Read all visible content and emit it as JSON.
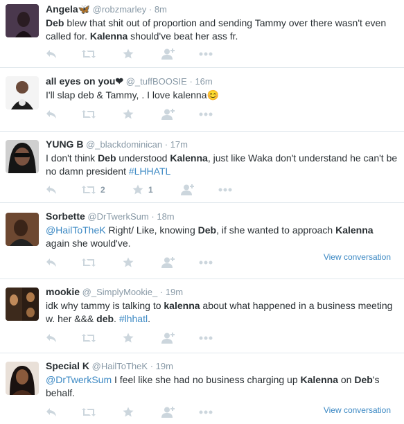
{
  "colors": {
    "link": "#3b88c3",
    "meta": "#8899a6",
    "action_icon": "#ccd6dd",
    "text": "#292f33",
    "divider": "#e1e8ed"
  },
  "tweets": [
    {
      "name": "Angela🦋",
      "handle": "@robzmarley",
      "time": "8m",
      "text": [
        {
          "b": "Deb"
        },
        {
          "t": " blew that shit out of proportion and sending Tammy over there wasn't even called for. "
        },
        {
          "b": "Kalenna"
        },
        {
          "t": " should've beat her ass fr."
        }
      ],
      "retweets": "",
      "favorites": "",
      "view_conversation": ""
    },
    {
      "name": "all eyes on you❤",
      "handle": "@_tuffBOOSIE",
      "time": "16m",
      "text": [
        {
          "t": "I'll slap deb & Tammy, . I love kalenna😊"
        }
      ],
      "retweets": "",
      "favorites": "",
      "view_conversation": ""
    },
    {
      "name": "YUNG B",
      "handle": "@_blackdominican",
      "time": "17m",
      "text": [
        {
          "t": "I don't think "
        },
        {
          "b": "Deb"
        },
        {
          "t": " understood "
        },
        {
          "b": "Kalenna"
        },
        {
          "t": ", just like Waka don't understand he can't be no damn president  "
        },
        {
          "l": "#LHHATL"
        }
      ],
      "retweets": "2",
      "favorites": "1",
      "view_conversation": ""
    },
    {
      "name": "Sorbette",
      "handle": "@DrTwerkSum",
      "time": "18m",
      "text": [
        {
          "l": "@HailToTheK"
        },
        {
          "t": " Right/ Like, knowing "
        },
        {
          "b": "Deb"
        },
        {
          "t": ", if she wanted to approach "
        },
        {
          "b": "Kalenna"
        },
        {
          "t": " again she would've."
        }
      ],
      "retweets": "",
      "favorites": "",
      "view_conversation": "View conversation"
    },
    {
      "name": "mookie",
      "handle": "@_SimplyMookie_",
      "time": "19m",
      "text": [
        {
          "t": "idk why tammy is talking to "
        },
        {
          "b": "kalenna"
        },
        {
          "t": " about what happened in a business meeting w. her &&& "
        },
        {
          "b": "deb"
        },
        {
          "t": ". "
        },
        {
          "l": "#lhhatl"
        },
        {
          "t": "."
        }
      ],
      "retweets": "",
      "favorites": "",
      "view_conversation": ""
    },
    {
      "name": "Special K",
      "handle": "@HailToTheK",
      "time": "19m",
      "text": [
        {
          "l": "@DrTwerkSum"
        },
        {
          "t": " I feel like she had no business charging up "
        },
        {
          "b": "Kalenna"
        },
        {
          "t": " on "
        },
        {
          "b": "Deb"
        },
        {
          "t": "'s behalf."
        }
      ],
      "retweets": "",
      "favorites": "",
      "view_conversation": "View conversation"
    }
  ]
}
